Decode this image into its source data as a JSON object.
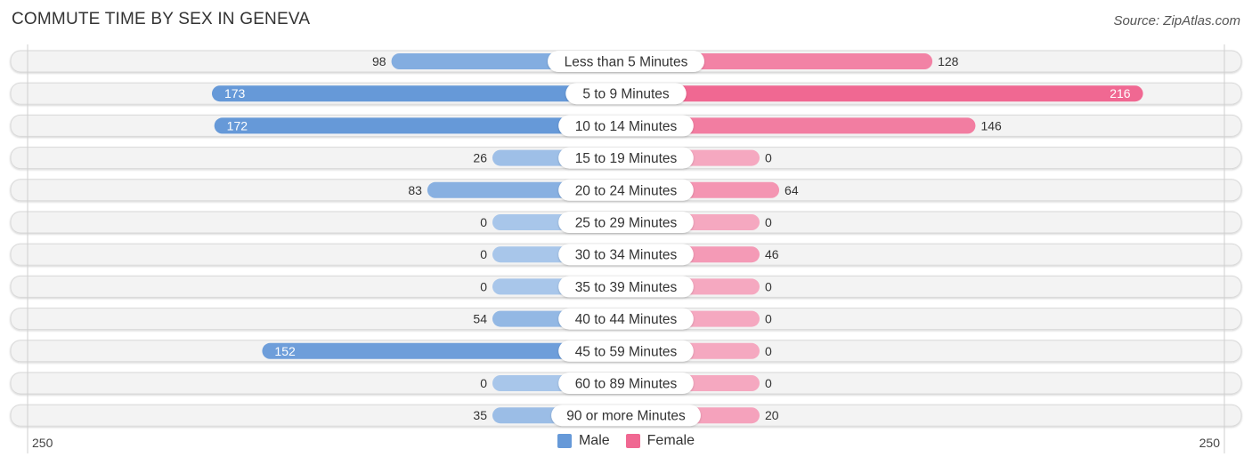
{
  "title": "COMMUTE TIME BY SEX IN GENEVA",
  "source": "Source: ZipAtlas.com",
  "colors": {
    "male_strong": "#6699d8",
    "male_light": "#a8c6ea",
    "female_strong": "#f06892",
    "female_light": "#f5a8c0",
    "row_bg": "#f3f3f3",
    "row_border": "#d9d9d9"
  },
  "legend": [
    {
      "label": "Male",
      "color": "#6699d8"
    },
    {
      "label": "Female",
      "color": "#f06892"
    }
  ],
  "axis": {
    "left_label": "250",
    "right_label": "250"
  },
  "chart_data": {
    "type": "bar",
    "orientation": "horizontal-butterfly",
    "title": "COMMUTE TIME BY SEX IN GENEVA",
    "xlabel": "",
    "ylabel": "",
    "xlim": [
      -250,
      250
    ],
    "legend_position": "bottom-center",
    "grid": false,
    "categories": [
      "Less than 5 Minutes",
      "5 to 9 Minutes",
      "10 to 14 Minutes",
      "15 to 19 Minutes",
      "20 to 24 Minutes",
      "25 to 29 Minutes",
      "30 to 34 Minutes",
      "35 to 39 Minutes",
      "40 to 44 Minutes",
      "45 to 59 Minutes",
      "60 to 89 Minutes",
      "90 or more Minutes"
    ],
    "series": [
      {
        "name": "Male",
        "side": "left",
        "values": [
          98,
          173,
          172,
          26,
          83,
          0,
          0,
          0,
          54,
          152,
          0,
          35
        ]
      },
      {
        "name": "Female",
        "side": "right",
        "values": [
          128,
          216,
          146,
          0,
          64,
          0,
          46,
          0,
          0,
          0,
          0,
          20
        ]
      }
    ]
  }
}
